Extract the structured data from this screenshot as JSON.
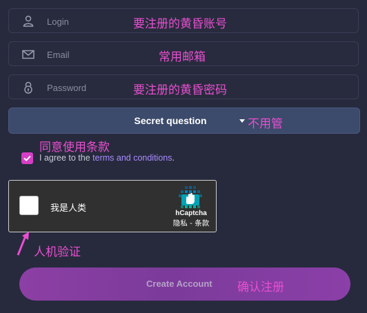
{
  "form": {
    "login_placeholder": "Login",
    "email_placeholder": "Email",
    "password_placeholder": "Password",
    "secret_question": "Secret question",
    "agree_prefix": "I agree to the ",
    "agree_link": "terms and conditions",
    "agree_suffix": ".",
    "agree_checked": true,
    "create_button": "Create Account"
  },
  "captcha": {
    "checkbox_label": "我是人类",
    "brand": "hCaptcha",
    "links": "隐私 - 条款"
  },
  "annotations": {
    "login": "要注册的黄昏账号",
    "email": "常用邮箱",
    "password": "要注册的黄昏密码",
    "secret": "不用管",
    "agree": "同意使用条款",
    "captcha": "人机验证",
    "create": "确认注册"
  },
  "colors": {
    "background": "#272a3d",
    "annotation": "#e84fd0",
    "select_bg": "#3c4a6b",
    "checkbox": "#d53fc7",
    "link": "#a98cff",
    "button_gradient_start": "#8c3fa4"
  },
  "icons": [
    "user-icon",
    "envelope-icon",
    "lock-icon",
    "caret-down-icon",
    "check-icon",
    "hcaptcha-logo-icon",
    "annotation-arrow"
  ]
}
